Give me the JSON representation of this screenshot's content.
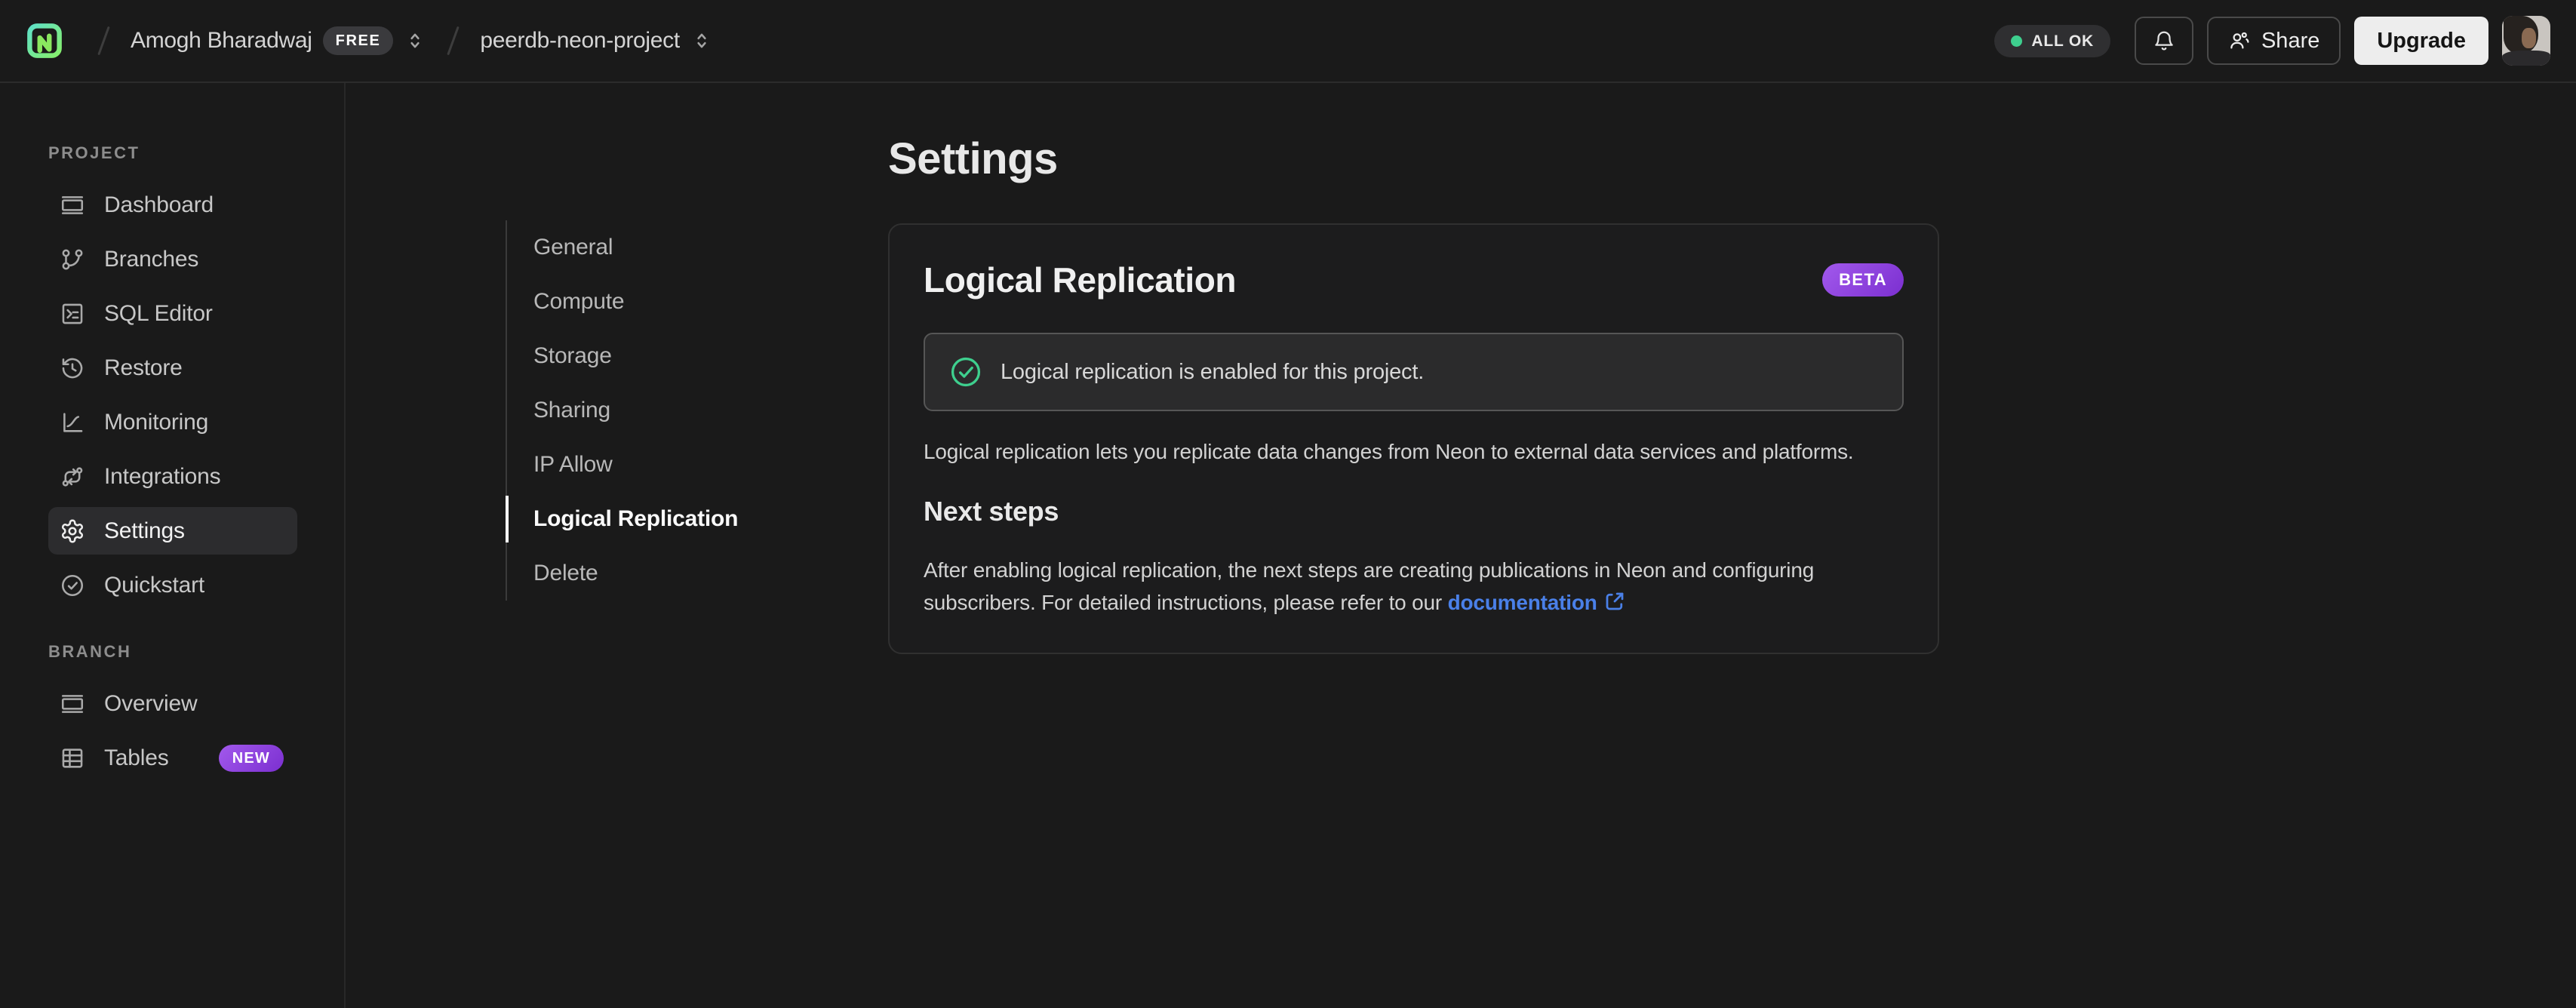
{
  "header": {
    "org_name": "Amogh Bharadwaj",
    "org_plan": "FREE",
    "project_name": "peerdb-neon-project",
    "status": "ALL OK",
    "share": "Share",
    "upgrade": "Upgrade"
  },
  "sidebar": {
    "project_label": "PROJECT",
    "project_items": [
      {
        "label": "Dashboard",
        "icon": "dashboard-icon"
      },
      {
        "label": "Branches",
        "icon": "git-branch-icon"
      },
      {
        "label": "SQL Editor",
        "icon": "terminal-icon"
      },
      {
        "label": "Restore",
        "icon": "history-icon"
      },
      {
        "label": "Monitoring",
        "icon": "chart-icon"
      },
      {
        "label": "Integrations",
        "icon": "workflow-icon"
      },
      {
        "label": "Settings",
        "icon": "gear-icon",
        "active": true
      },
      {
        "label": "Quickstart",
        "icon": "check-circle-icon"
      }
    ],
    "branch_label": "BRANCH",
    "branch_items": [
      {
        "label": "Overview",
        "icon": "dashboard-icon"
      },
      {
        "label": "Tables",
        "icon": "table-icon",
        "badge": "NEW"
      }
    ]
  },
  "settings_nav": {
    "items": [
      "General",
      "Compute",
      "Storage",
      "Sharing",
      "IP Allow",
      "Logical Replication",
      "Delete"
    ],
    "active": "Logical Replication"
  },
  "main": {
    "title": "Settings",
    "card": {
      "title": "Logical Replication",
      "badge": "BETA",
      "alert_text": "Logical replication is enabled for this project.",
      "description": "Logical replication lets you replicate data changes from Neon to external data services and platforms.",
      "next_steps_title": "Next steps",
      "next_steps_body": "After enabling logical replication, the next steps are creating publications in Neon and configuring subscribers. For detailed instructions, please refer to our ",
      "link_label": "documentation"
    }
  },
  "colors": {
    "accent-green": "#3ecf8e",
    "badge-purple-1": "#a259ec",
    "badge-purple-2": "#7b2fd0",
    "link-blue": "#4a80e8"
  }
}
